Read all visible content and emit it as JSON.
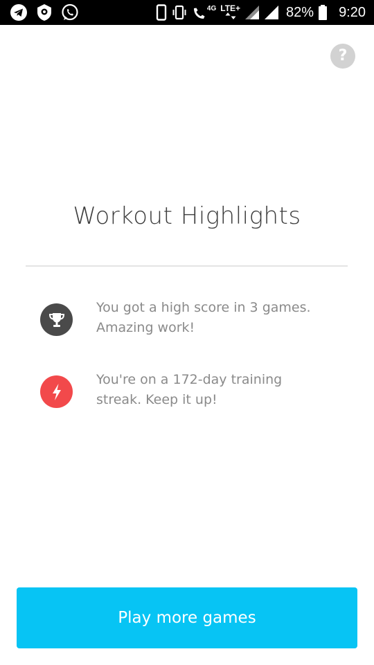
{
  "status_bar": {
    "left_icons": [
      "telegram-icon",
      "shield-app-icon",
      "whatsapp-icon"
    ],
    "right_icons": [
      "phone-outline-icon",
      "vibrate-icon",
      "wifi-call-icon",
      "signal-icon",
      "signal-icon",
      "battery-icon"
    ],
    "network_4g": "4G",
    "network_lte": "LTE+",
    "battery_percent": "82%",
    "time": "9:20"
  },
  "help": {
    "label": "?"
  },
  "main": {
    "title": "Workout Highlights",
    "highlights": [
      {
        "icon": "trophy-icon",
        "icon_color": "#4a4a4a",
        "line1": "You got a high score in 3 games.",
        "line2": "Amazing work!"
      },
      {
        "icon": "lightning-icon",
        "icon_color": "#f2494b",
        "line1": "You're on a 172-day training",
        "line2": "streak. Keep it up!"
      }
    ]
  },
  "cta": {
    "label": "Play more games",
    "color": "#07c4f4"
  }
}
